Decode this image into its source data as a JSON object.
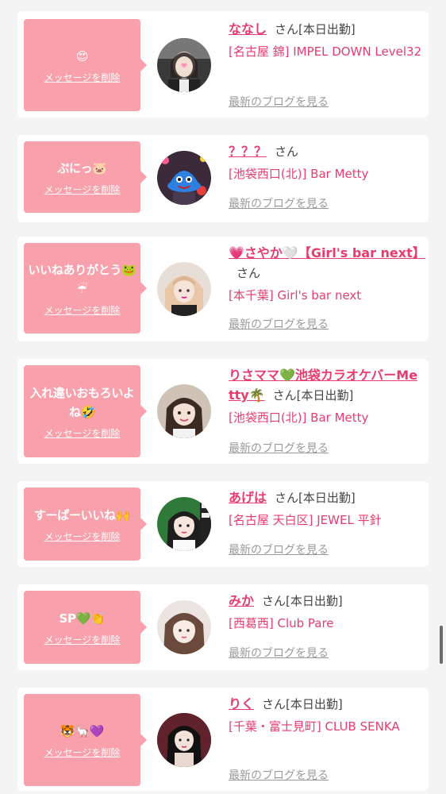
{
  "colors": {
    "accent": "#e83c70",
    "message_bg": "#f8a0ac",
    "link_gray": "#9a9a9a",
    "page_bg": "#f4f4f4"
  },
  "common": {
    "delete_label": "メッセージを削除",
    "blog_label": "最新のブログを見る",
    "san": "さん"
  },
  "items": [
    {
      "message": "😍",
      "name": "ななし",
      "duty": "[本日出勤]",
      "shop": "[名古屋 錦] IMPEL DOWN Level32"
    },
    {
      "message": "ぷにっ🐷",
      "name": "？？？",
      "duty": "",
      "shop": "[池袋西口(北)] Bar Metty"
    },
    {
      "message": "いいねありがとう🐸☔",
      "name": "💗さやか🤍【Girl's bar next】",
      "duty": "",
      "shop": "[本千葉] Girl's bar next"
    },
    {
      "message": "入れ違いおもろいよね🤣",
      "name": "りさママ💚池袋カラオケバーMetty🌴",
      "duty": "[本日出勤]",
      "shop": "[池袋西口(北)] Bar Metty"
    },
    {
      "message": "すーぱーいいね🙌",
      "name": "あげは",
      "duty": "[本日出勤]",
      "shop": "[名古屋 天白区] JEWEL 平針"
    },
    {
      "message": "SP💚👏",
      "name": "みか",
      "duty": "[本日出勤]",
      "shop": "[西葛西] Club Pare"
    },
    {
      "message": "🐯🦙💜",
      "name": "りく",
      "duty": "[本日出勤]",
      "shop": "[千葉・富士見町] CLUB SENKA"
    }
  ]
}
